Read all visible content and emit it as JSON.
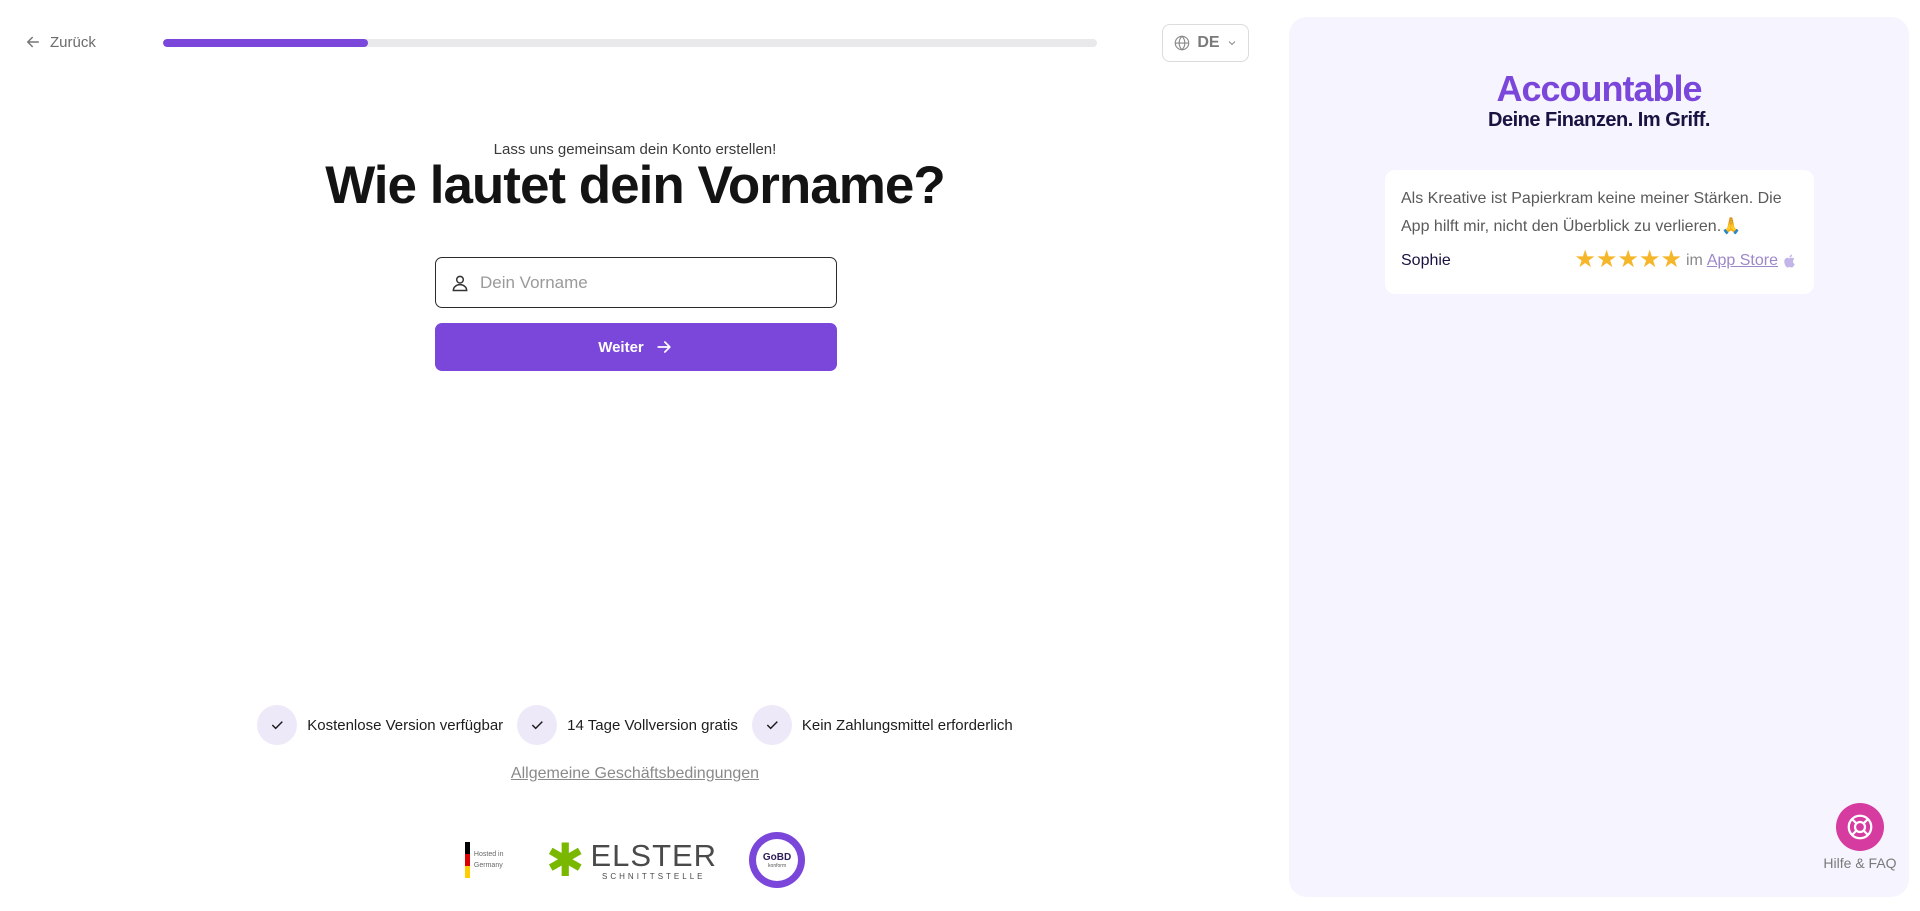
{
  "header": {
    "back_label": "Zurück",
    "progress": 0.22,
    "language": "DE"
  },
  "main": {
    "subtitle": "Lass uns gemeinsam dein Konto erstellen!",
    "title": "Wie lautet dein Vorname?",
    "name_input": {
      "value": "",
      "placeholder": "Dein Vorname"
    },
    "continue_label": "Weiter"
  },
  "features": [
    {
      "label": "Kostenlose Version verfügbar",
      "icon": "check-icon"
    },
    {
      "label": "14 Tage Vollversion gratis",
      "icon": "check-icon"
    },
    {
      "label": "Kein Zahlungsmittel erforderlich",
      "icon": "check-icon"
    }
  ],
  "terms_label": "Allgemeine Geschäftsbedingungen",
  "badges": {
    "hosted": "Hosted in Germany",
    "elster_main": "ELSTER",
    "elster_sub": "SCHNITTSTELLE",
    "gobd_main": "GoBD",
    "gobd_sub": "konform"
  },
  "sidebar": {
    "brand_name": "Accountable",
    "brand_claim": "Deine Finanzen. Im Griff.",
    "review": {
      "text": "Als Kreative ist Papierkram keine meiner Stärken. Die App hilft mir, nicht den Überblick zu verlieren.🙏",
      "author": "Sophie",
      "stars": 5,
      "store_prefix": "im",
      "store_label": "App Store"
    },
    "help_label": "Hilfe & FAQ"
  },
  "colors": {
    "accent": "#7b47db",
    "help_button": "#d63ca0",
    "panel_bg": "#f6f4fe",
    "star": "#f5b62a"
  }
}
